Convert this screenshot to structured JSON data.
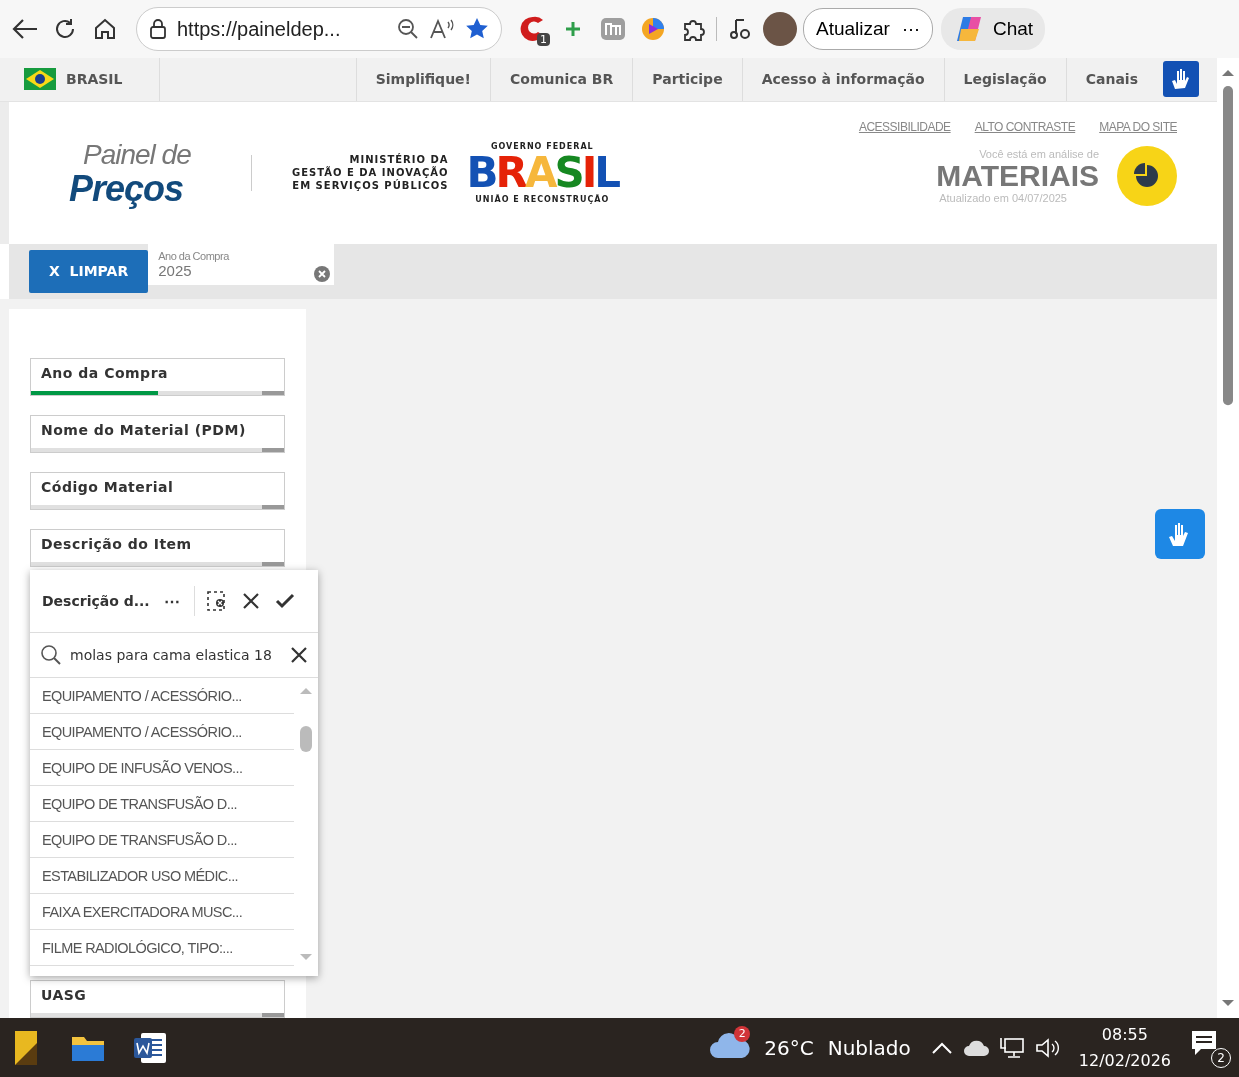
{
  "browser": {
    "address": "https://paineldep...",
    "extension_badge": "1",
    "update_button": "Atualizar",
    "more": "⋯",
    "chat": "Chat"
  },
  "gov_bar": {
    "country": "BRASIL",
    "links": [
      "Simplifique!",
      "Comunica BR",
      "Participe",
      "Acesso à informação",
      "Legislação",
      "Canais"
    ]
  },
  "header": {
    "logo_top": "Painel de",
    "logo_bottom": "Preços",
    "ministry": [
      "MINISTÉRIO DA",
      "GESTÃO E DA INOVAÇÃO",
      "EM SERVIÇOS PÚBLICOS"
    ],
    "gov_top": "GOVERNO FEDERAL",
    "gov_word": "BRASIL",
    "gov_bottom": "UNIÃO E RECONSTRUÇÃO",
    "links": [
      "ACESSIBILIDADE",
      "ALTO CONTRASTE",
      "MAPA DO SITE"
    ],
    "analysis_label": "Você está em análise de",
    "analysis_value": "MATERIAIS",
    "updated": "Atualizado em 04/07/2025"
  },
  "selection_bar": {
    "clear_button": "X  LIMPAR",
    "chips": [
      {
        "label": "Ano da Compra",
        "value": "2025"
      }
    ]
  },
  "filters": [
    {
      "label": "Ano da Compra",
      "level": 0.5
    },
    {
      "label": "Nome do Material (PDM)"
    },
    {
      "label": "Código Material"
    },
    {
      "label": "Descrição do Item"
    },
    {
      "label": "UASG"
    }
  ],
  "popup": {
    "title": "Descrição d...",
    "more": "⋯",
    "search_value": "molas para cama elastica 18",
    "items": [
      "EQUIPAMENTO / ACESSÓRIO...",
      "EQUIPAMENTO / ACESSÓRIO...",
      "EQUIPO DE INFUSÃO VENOS...",
      "EQUIPO DE TRANSFUSÃO D...",
      "EQUIPO DE TRANSFUSÃO D...",
      "ESTABILIZADOR USO MÉDIC...",
      "FAIXA EXERCITADORA MUSC...",
      "FILME RADIOLÓGICO, TIPO:..."
    ]
  },
  "taskbar": {
    "weather_badge": "2",
    "temperature": "26°C",
    "weather": "Nublado",
    "time": "08:55",
    "date": "12/02/2026",
    "notifications": "2"
  }
}
